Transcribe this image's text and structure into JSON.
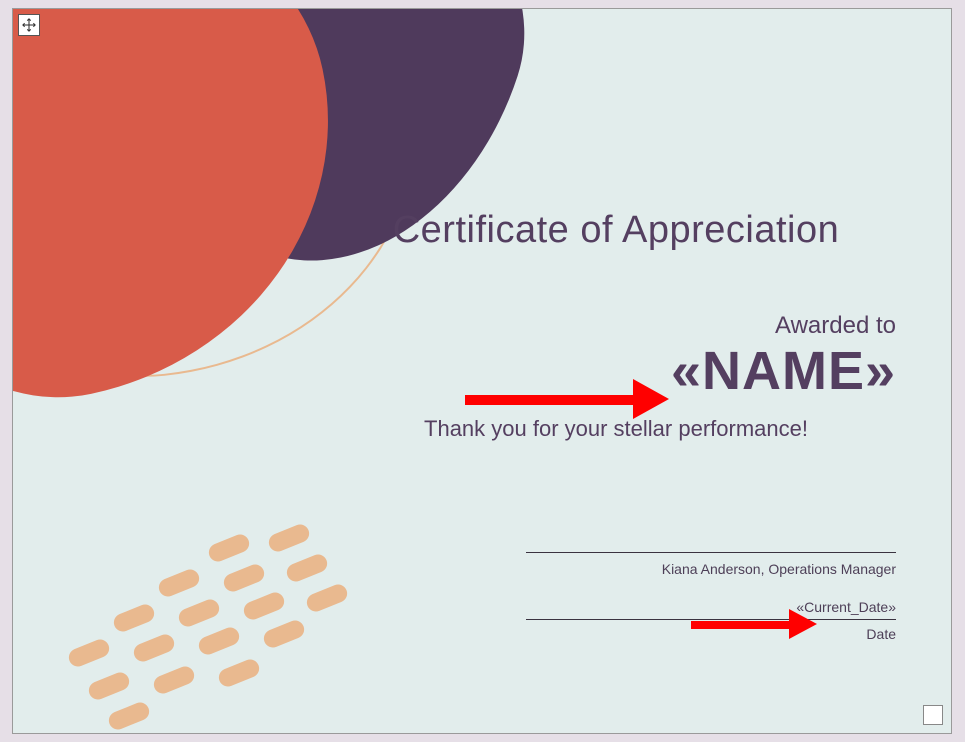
{
  "certificate": {
    "title": "Certificate of Appreciation",
    "awarded_label": "Awarded to",
    "name_field": "«NAME»",
    "thankyou": "Thank you for your stellar performance!",
    "signer": "Kiana Anderson, Operations Manager",
    "date_field": "«Current_Date»",
    "date_label": "Date"
  },
  "colors": {
    "background": "#e2edec",
    "accent_purple": "#543f60",
    "blob_red": "#d85b49",
    "blob_purple": "#4f3a5c",
    "blob_outline": "#e9b98f",
    "annotation_red": "#ff0000"
  },
  "icons": {
    "move_handle": "move-icon",
    "resize_handle": "resize-square"
  }
}
